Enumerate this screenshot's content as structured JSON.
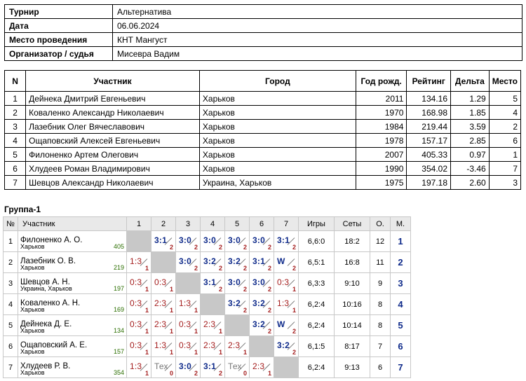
{
  "info": {
    "rows": [
      {
        "label": "Турнир",
        "value": "Альтернатива"
      },
      {
        "label": "Дата",
        "value": "06.06.2024"
      },
      {
        "label": "Место проведения",
        "value": "КНТ Мангуст"
      },
      {
        "label": "Организатор / судья",
        "value": "Мисевра Вадим"
      }
    ]
  },
  "participants": {
    "headers": {
      "n": "N",
      "name": "Участник",
      "city": "Город",
      "year": "Год рожд.",
      "rating": "Рейтинг",
      "delta": "Дельта",
      "place": "Место"
    },
    "rows": [
      {
        "n": "1",
        "name": "Дейнека Дмитрий Евгеньевич",
        "city": "Харьков",
        "year": "2011",
        "rating": "134.16",
        "delta": "1.29",
        "place": "5"
      },
      {
        "n": "2",
        "name": "Коваленко Александр Николаевич",
        "city": "Харьков",
        "year": "1970",
        "rating": "168.98",
        "delta": "1.85",
        "place": "4"
      },
      {
        "n": "3",
        "name": "Лазебник Олег Вячеславович",
        "city": "Харьков",
        "year": "1984",
        "rating": "219.44",
        "delta": "3.59",
        "place": "2"
      },
      {
        "n": "4",
        "name": "Ощаповский Алексей Евгеньевич",
        "city": "Харьков",
        "year": "1978",
        "rating": "157.17",
        "delta": "2.85",
        "place": "6"
      },
      {
        "n": "5",
        "name": "Филоненко Артем Олегович",
        "city": "Харьков",
        "year": "2007",
        "rating": "405.33",
        "delta": "0.97",
        "place": "1"
      },
      {
        "n": "6",
        "name": "Хлудеев Роман Владимирович",
        "city": "Харьков",
        "year": "1990",
        "rating": "354.02",
        "delta": "-3.46",
        "place": "7"
      },
      {
        "n": "7",
        "name": "Шевцов Александр Николаевич",
        "city": "Украина, Харьков",
        "year": "1975",
        "rating": "197.18",
        "delta": "2.60",
        "place": "3"
      }
    ]
  },
  "group": {
    "title": "Группа-1",
    "headers": {
      "n": "№",
      "name": "Участник",
      "cols": [
        "1",
        "2",
        "3",
        "4",
        "5",
        "6",
        "7"
      ],
      "games": "Игры",
      "sets": "Сеты",
      "points": "О.",
      "place": "М."
    },
    "rows": [
      {
        "n": "1",
        "name": "Филоненко А. О.",
        "city": "Харьков",
        "rating": "405",
        "results": [
          null,
          {
            "s": "3:1",
            "r": "2",
            "t": "win"
          },
          {
            "s": "3:0",
            "r": "2",
            "t": "win"
          },
          {
            "s": "3:0",
            "r": "2",
            "t": "win"
          },
          {
            "s": "3:0",
            "r": "2",
            "t": "win"
          },
          {
            "s": "3:0",
            "r": "2",
            "t": "win"
          },
          {
            "s": "3:1",
            "r": "2",
            "t": "win"
          }
        ],
        "games": "6,6:0",
        "sets": "18:2",
        "points": "12",
        "place": "1"
      },
      {
        "n": "2",
        "name": "Лазебник О. В.",
        "city": "Харьков",
        "rating": "219",
        "results": [
          {
            "s": "1:3",
            "r": "1",
            "t": "loss"
          },
          null,
          {
            "s": "3:0",
            "r": "2",
            "t": "win"
          },
          {
            "s": "3:2",
            "r": "2",
            "t": "win"
          },
          {
            "s": "3:2",
            "r": "2",
            "t": "win"
          },
          {
            "s": "3:1",
            "r": "2",
            "t": "win"
          },
          {
            "s": "W",
            "r": "2",
            "t": "win"
          }
        ],
        "games": "6,5:1",
        "sets": "16:8",
        "points": "11",
        "place": "2"
      },
      {
        "n": "3",
        "name": "Шевцов А. Н.",
        "city": "Украина, Харьков",
        "rating": "197",
        "results": [
          {
            "s": "0:3",
            "r": "1",
            "t": "loss"
          },
          {
            "s": "0:3",
            "r": "1",
            "t": "loss"
          },
          null,
          {
            "s": "3:1",
            "r": "2",
            "t": "win"
          },
          {
            "s": "3:0",
            "r": "2",
            "t": "win"
          },
          {
            "s": "3:0",
            "r": "2",
            "t": "win"
          },
          {
            "s": "0:3",
            "r": "1",
            "t": "loss"
          }
        ],
        "games": "6,3:3",
        "sets": "9:10",
        "points": "9",
        "place": "3"
      },
      {
        "n": "4",
        "name": "Коваленко А. Н.",
        "city": "Харьков",
        "rating": "169",
        "results": [
          {
            "s": "0:3",
            "r": "1",
            "t": "loss"
          },
          {
            "s": "2:3",
            "r": "1",
            "t": "loss"
          },
          {
            "s": "1:3",
            "r": "1",
            "t": "loss"
          },
          null,
          {
            "s": "3:2",
            "r": "2",
            "t": "win"
          },
          {
            "s": "3:2",
            "r": "2",
            "t": "win"
          },
          {
            "s": "1:3",
            "r": "1",
            "t": "loss"
          }
        ],
        "games": "6,2:4",
        "sets": "10:16",
        "points": "8",
        "place": "4"
      },
      {
        "n": "5",
        "name": "Дейнека Д. Е.",
        "city": "Харьков",
        "rating": "134",
        "results": [
          {
            "s": "0:3",
            "r": "1",
            "t": "loss"
          },
          {
            "s": "2:3",
            "r": "1",
            "t": "loss"
          },
          {
            "s": "0:3",
            "r": "1",
            "t": "loss"
          },
          {
            "s": "2:3",
            "r": "1",
            "t": "loss"
          },
          null,
          {
            "s": "3:2",
            "r": "2",
            "t": "win"
          },
          {
            "s": "W",
            "r": "2",
            "t": "win"
          }
        ],
        "games": "6,2:4",
        "sets": "10:14",
        "points": "8",
        "place": "5"
      },
      {
        "n": "6",
        "name": "Ощаповский А. Е.",
        "city": "Харьков",
        "rating": "157",
        "results": [
          {
            "s": "0:3",
            "r": "1",
            "t": "loss"
          },
          {
            "s": "1:3",
            "r": "1",
            "t": "loss"
          },
          {
            "s": "0:3",
            "r": "1",
            "t": "loss"
          },
          {
            "s": "2:3",
            "r": "1",
            "t": "loss"
          },
          {
            "s": "2:3",
            "r": "1",
            "t": "loss"
          },
          null,
          {
            "s": "3:2",
            "r": "2",
            "t": "win"
          }
        ],
        "games": "6,1:5",
        "sets": "8:17",
        "points": "7",
        "place": "6"
      },
      {
        "n": "7",
        "name": "Хлудеев Р. В.",
        "city": "Харьков",
        "rating": "354",
        "results": [
          {
            "s": "1:3",
            "r": "1",
            "t": "loss"
          },
          {
            "s": "Тех",
            "r": "0",
            "t": "tech"
          },
          {
            "s": "3:0",
            "r": "2",
            "t": "win"
          },
          {
            "s": "3:1",
            "r": "2",
            "t": "win"
          },
          {
            "s": "Тех",
            "r": "0",
            "t": "tech"
          },
          {
            "s": "2:3",
            "r": "1",
            "t": "loss"
          },
          null
        ],
        "games": "6,2:4",
        "sets": "9:13",
        "points": "6",
        "place": "7"
      }
    ]
  }
}
